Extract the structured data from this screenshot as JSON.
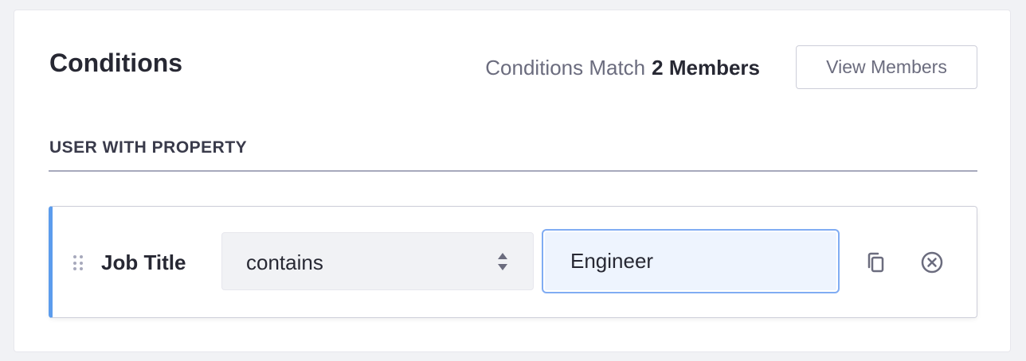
{
  "panel": {
    "title": "Conditions",
    "match_label": "Conditions Match",
    "match_count": "2 Members",
    "view_members_label": "View Members"
  },
  "section": {
    "label": "USER WITH PROPERTY"
  },
  "criteria": {
    "property_label": "Job Title",
    "operator": "contains",
    "value": "Engineer",
    "icons": {
      "drag": "drag-handle-icon",
      "operator_caret": "up-down-caret-icon",
      "duplicate": "copy-icon",
      "remove": "remove-circle-icon"
    }
  },
  "colors": {
    "accent_bar": "#5c9ced",
    "input_focus_border": "#80acf3",
    "input_focus_bg": "#eef4fe",
    "text_primary": "#272833",
    "text_secondary": "#6b6c7e"
  }
}
